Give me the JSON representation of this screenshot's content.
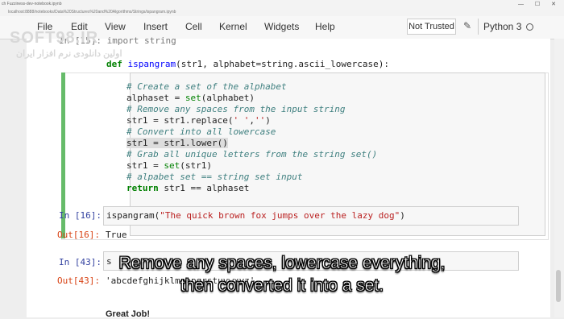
{
  "browser": {
    "tab_text": "ch Fuzziness-dev-notebook.ipynb",
    "url_text": "localhost:8888/notebooks/Data%20Structures%20and%20Algorithms/Strings/ispangram.ipynb",
    "window_buttons": "— ☐ ✕"
  },
  "menu": [
    "File",
    "Edit",
    "View",
    "Insert",
    "Cell",
    "Kernel",
    "Widgets",
    "Help"
  ],
  "toolbar": {
    "trust_label": "Not Trusted",
    "kernel_label": "Python 3"
  },
  "watermark": {
    "line1": "SOFT98.IR",
    "line2": "اولین دانلودی نرم افزار ایران"
  },
  "cell1": {
    "prompt": "In [15]:",
    "lines": {
      "l0": "In [15]: import string",
      "l1_kw": "def ",
      "l1_fn": "ispangram",
      "l1_rest": "(str1, alphabet=string.ascii_lowercase):",
      "l2": "# Create a set of the alphabet",
      "l3_a": "alphaset = ",
      "l3_b": "set",
      "l3_c": "(alphabet)",
      "l4": "# Remove any spaces from the input string",
      "l5_a": "str1 = str1.replace(",
      "l5_b": "' '",
      "l5_c": ",",
      "l5_d": "''",
      "l5_e": ")",
      "l6": "# Convert into all lowercase",
      "l7": "str1 = str1.lower()",
      "l8": "# Grab all unique letters from the string set()",
      "l9_a": "str1 = ",
      "l9_b": "set",
      "l9_c": "(str1)",
      "l10": "# alpabet set == string set input",
      "l11_kw": "return",
      "l11_rest": " str1 == alphaset"
    }
  },
  "cell2": {
    "in_prompt": "In [16]:",
    "code_a": "ispangram(",
    "code_b": "\"The quick brown fox jumps over the lazy dog\"",
    "code_c": ")",
    "out_prompt": "Out[16]:",
    "output": "True"
  },
  "cell3": {
    "in_prompt": "In [43]:",
    "code_partial": "s",
    "out_prompt": "Out[43]:",
    "output": "'abcdefghijklmnopqrstuvwxyz'"
  },
  "markdown": "Great Job!",
  "subtitle": {
    "line1": "Remove any spaces, lowercase everything,",
    "line2": "then converted it into a set."
  }
}
